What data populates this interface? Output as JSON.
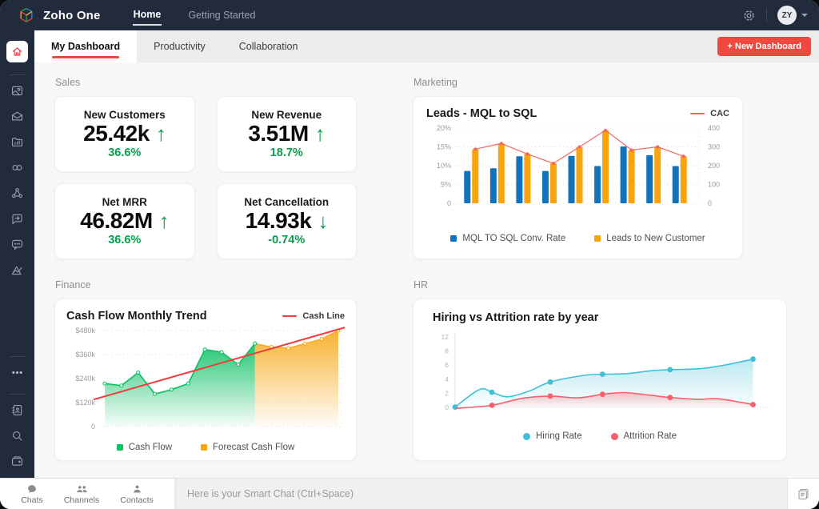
{
  "topbar": {
    "brand": "Zoho One",
    "nav": [
      {
        "label": "Home",
        "active": true
      },
      {
        "label": "Getting Started",
        "active": false
      }
    ],
    "avatar_initials": "ZY"
  },
  "tabs": [
    {
      "label": "My Dashboard",
      "active": true
    },
    {
      "label": "Productivity",
      "active": false
    },
    {
      "label": "Collaboration",
      "active": false
    }
  ],
  "new_dashboard_button": "+ New Dashboard",
  "sections": {
    "sales": "Sales",
    "marketing": "Marketing",
    "finance": "Finance",
    "hr": "HR"
  },
  "kpis": [
    {
      "title": "New Customers",
      "value": "25.42k",
      "direction": "up",
      "change": "36.6%"
    },
    {
      "title": "New Revenue",
      "value": "3.51M",
      "direction": "up",
      "change": "18.7%"
    },
    {
      "title": "Net MRR",
      "value": "46.82M",
      "direction": "up",
      "change": "36.6%"
    },
    {
      "title": "Net Cancellation",
      "value": "14.93k",
      "direction": "down",
      "change": "-0.74%"
    }
  ],
  "chart_data": [
    {
      "id": "marketing",
      "type": "bar",
      "title": "Leads - MQL to SQL",
      "left_axis": {
        "ticks": [
          "20%",
          "15%",
          "10%",
          "5%",
          "0"
        ],
        "max": 20
      },
      "right_axis": {
        "ticks": [
          "400",
          "300",
          "200",
          "100",
          "0"
        ],
        "max": 400
      },
      "series": [
        {
          "name": "MQL TO SQL Conv. Rate",
          "type": "bar",
          "axis": "left",
          "color": "#1272ba",
          "values": [
            8.6,
            9.3,
            12.5,
            8.6,
            12.6,
            9.9,
            15.1,
            12.8,
            9.9
          ]
        },
        {
          "name": "Leads to New Customer",
          "type": "bar",
          "axis": "right",
          "color": "#f7a40e",
          "values": [
            288,
            318,
            262,
            212,
            300,
            388,
            283,
            300,
            250
          ]
        },
        {
          "name": "CAC",
          "type": "line",
          "axis": "right",
          "color": "#f4655f",
          "values": [
            288,
            318,
            262,
            212,
            300,
            388,
            283,
            300,
            250
          ]
        }
      ],
      "legend_position": "bottom",
      "grid": true
    },
    {
      "id": "finance",
      "type": "area",
      "title": "Cash Flow Monthly Trend",
      "y_ticks": [
        "$480k",
        "$360k",
        "$240k",
        "$120k",
        "0"
      ],
      "y_max": 480,
      "series": [
        {
          "name": "Cash Flow",
          "color": "#0cbf63",
          "values": [
            215,
            205,
            270,
            163,
            185,
            215,
            385,
            372,
            310,
            415
          ]
        },
        {
          "name": "Forecast Cash Flow",
          "color": "#f7a40e",
          "values": [
            415,
            398,
            392,
            415,
            438,
            480
          ]
        }
      ],
      "trend": {
        "name": "Cash Line",
        "color": "#f23b3b",
        "start": 135,
        "end": 495
      },
      "legend_position": "bottom",
      "grid": true
    },
    {
      "id": "hr",
      "type": "line",
      "title": "Hiring vs Attrition rate by year",
      "y_ticks": [
        "12",
        "8",
        "6",
        "4",
        "2",
        "0"
      ],
      "series": [
        {
          "name": "Hiring Rate",
          "color": "#3fc0d8",
          "points": [
            [
              0.0,
              0.05
            ],
            [
              0.08,
              2.55
            ],
            [
              0.12,
              2.15
            ],
            [
              0.17,
              1.5
            ],
            [
              0.24,
              2.3
            ],
            [
              0.31,
              3.6
            ],
            [
              0.42,
              4.55
            ],
            [
              0.48,
              4.7
            ],
            [
              0.56,
              4.8
            ],
            [
              0.64,
              5.2
            ],
            [
              0.7,
              5.35
            ],
            [
              0.8,
              5.5
            ],
            [
              0.89,
              6.1
            ],
            [
              0.97,
              6.85
            ]
          ],
          "markers": [
            [
              0.0,
              0.05
            ],
            [
              0.12,
              2.15
            ],
            [
              0.31,
              3.6
            ],
            [
              0.48,
              4.7
            ],
            [
              0.7,
              5.35
            ],
            [
              0.97,
              6.85
            ]
          ]
        },
        {
          "name": "Attrition Rate",
          "color": "#f4606c",
          "points": [
            [
              0.0,
              -0.15
            ],
            [
              0.12,
              0.3
            ],
            [
              0.22,
              1.3
            ],
            [
              0.31,
              1.6
            ],
            [
              0.4,
              1.35
            ],
            [
              0.48,
              1.85
            ],
            [
              0.55,
              2.1
            ],
            [
              0.63,
              1.75
            ],
            [
              0.7,
              1.4
            ],
            [
              0.79,
              1.15
            ],
            [
              0.86,
              1.2
            ],
            [
              0.97,
              0.4
            ]
          ],
          "markers": [
            [
              0.12,
              0.3
            ],
            [
              0.31,
              1.6
            ],
            [
              0.48,
              1.85
            ],
            [
              0.7,
              1.4
            ],
            [
              0.97,
              0.4
            ]
          ]
        }
      ],
      "legend_position": "bottom",
      "grid": false
    }
  ],
  "bottombar": {
    "items": [
      {
        "label": "Chats"
      },
      {
        "label": "Channels"
      },
      {
        "label": "Contacts"
      }
    ],
    "smart_chat_placeholder": "Here is your Smart Chat (Ctrl+Space)"
  },
  "colors": {
    "accent_red": "#f0483e",
    "green": "#0a9b4c",
    "topbar_bg": "#212b3c"
  }
}
